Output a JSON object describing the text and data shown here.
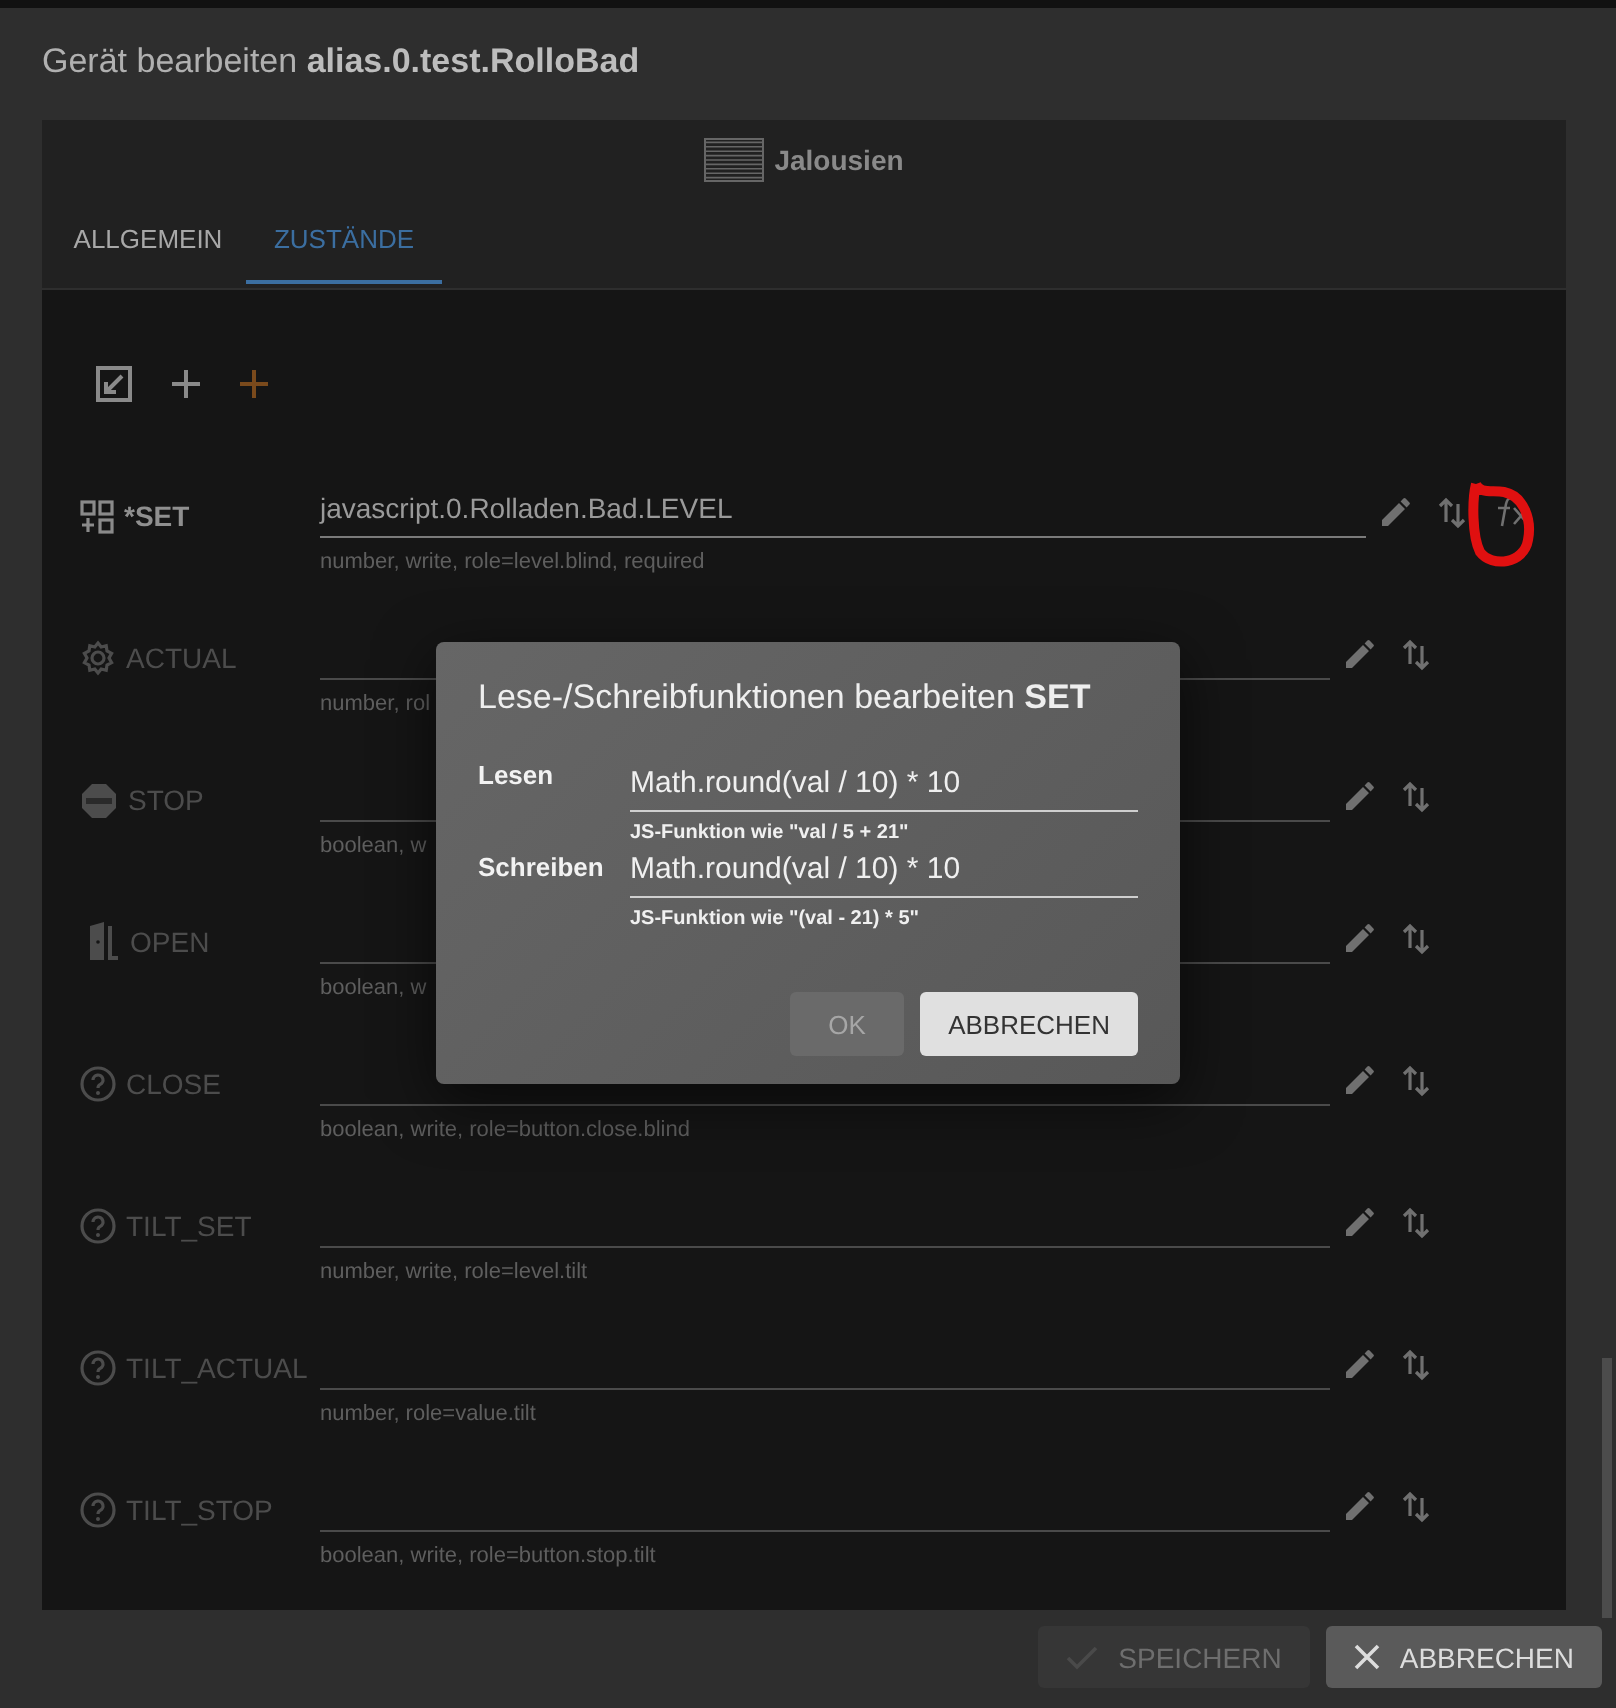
{
  "window": {
    "title": "Gerät bearbeiten **alias.0.test.RolloBad**"
  },
  "device": {
    "type": "Jalousien"
  },
  "tabs": [
    {
      "label": "ALLGEMEIN",
      "selected": false
    },
    {
      "label": "ZUSTÄNDE",
      "selected": true
    }
  ],
  "states": [
    {
      "name": "*SET",
      "kind": "level",
      "value": "javascript.0.Rolladen.Bad.LEVEL",
      "hint": "number, write, role=level.blind, required",
      "required": true,
      "function": true
    },
    {
      "name": "ACTUAL",
      "kind": "value",
      "hint": "number, rol",
      "required": false,
      "function": false
    },
    {
      "name": "STOP",
      "kind": "stop",
      "hint": "boolean, w",
      "required": false,
      "function": false
    },
    {
      "name": "OPEN",
      "kind": "door",
      "hint": "boolean, w",
      "required": false,
      "function": false
    },
    {
      "name": "CLOSE",
      "kind": "unknown",
      "hint": "boolean, write, role=button.close.blind",
      "required": false,
      "function": false
    },
    {
      "name": "TILT_SET",
      "kind": "unknown",
      "hint": "number, write, role=level.tilt",
      "required": false,
      "function": false
    },
    {
      "name": "TILT_ACTUAL",
      "kind": "unknown",
      "hint": "number, role=value.tilt",
      "required": false,
      "function": false
    },
    {
      "name": "TILT_STOP",
      "kind": "unknown",
      "hint": "boolean, write, role=button.stop.tilt",
      "required": false,
      "function": false
    }
  ],
  "dialog": {
    "title": "Lese-/Schreibfunktionen bearbeiten **SET**",
    "fields": [
      {
        "label": "Lesen",
        "value": "Math.round(val / 10) * 10",
        "helper": "JS-Funktion wie \"val / 5 + 21\""
      },
      {
        "label": "Schreiben",
        "value": "Math.round(val / 10) * 10",
        "helper": "JS-Funktion wie \"(val - 21) * 5\""
      }
    ],
    "buttons": [
      {
        "label": "OK",
        "disabled": true
      },
      {
        "label": "ABBRECHEN",
        "disabled": false
      }
    ]
  },
  "footer": {
    "buttons": [
      {
        "label": "SPEICHERN",
        "kind": "save",
        "disabled": true
      },
      {
        "label": "ABBRECHEN",
        "kind": "cancel",
        "disabled": false
      }
    ]
  }
}
